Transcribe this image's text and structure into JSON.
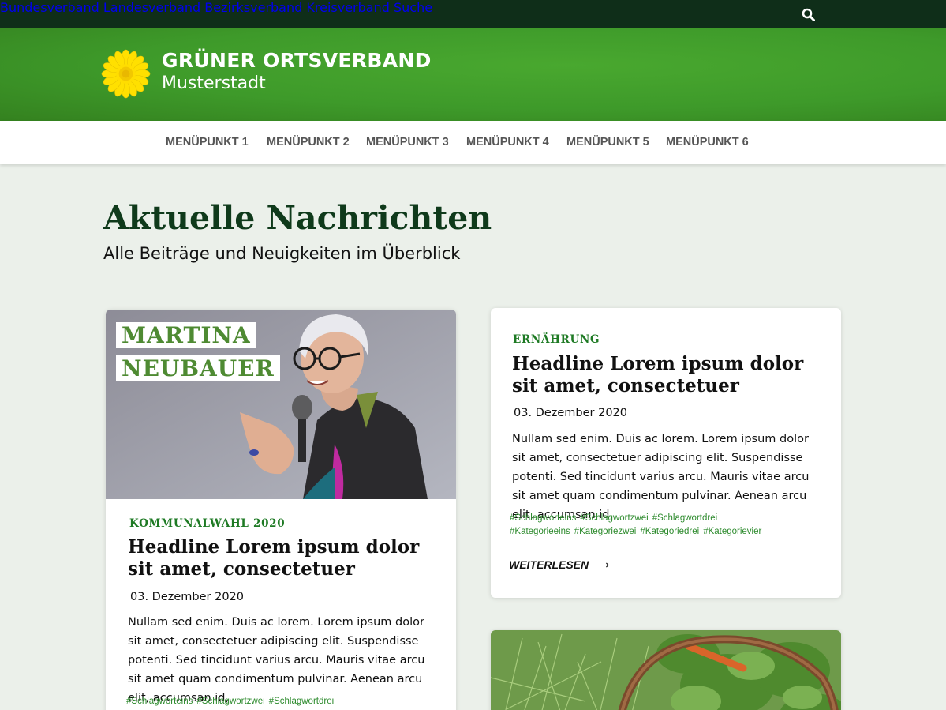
{
  "topbar": {
    "links": [
      "Bundesverband",
      "Landesverband",
      "Bezirksverband",
      "Kreisverband"
    ],
    "search_label": "Suche"
  },
  "header": {
    "org_name": "GRÜNER ORTSVERBAND",
    "city": "Musterstadt",
    "logo_icon": "sunflower-icon"
  },
  "mainnav": {
    "items": [
      "MENÜPUNKT 1",
      "MENÜPUNKT 2",
      "MENÜPUNKT 3",
      "MENÜPUNKT 4",
      "MENÜPUNKT 5",
      "MENÜPUNKT 6"
    ]
  },
  "page": {
    "title": "Aktuelle Nachrichten",
    "subtitle": "Alle Beiträge und Neuigkeiten im Überblick"
  },
  "cards": [
    {
      "image_label_line1": "MARTINA",
      "image_label_line2": "NEUBAUER",
      "kicker": "KOMMUNALWAHL 2020",
      "headline": "Headline Lorem ipsum dolor sit amet, consectetuer",
      "date": "03. Dezember 2020",
      "text": "Nullam sed enim. Duis ac lorem. Lorem ipsum dolor sit amet, consectetuer adipiscing elit. Suspendisse potenti. Sed tincidunt varius arcu. Mauris vitae arcu sit amet quam condimentum pulvinar. Aenean arcu elit, accumsan id,",
      "tags": [
        "#Schlagworteins",
        "#Schlagwortzwei",
        "#Schlagwortdrei"
      ]
    },
    {
      "kicker": "ERNÄHRUNG",
      "headline": "Headline Lorem ipsum dolor sit amet, consectetuer",
      "date": "03. Dezember 2020",
      "text": "Nullam sed enim. Duis ac lorem. Lorem ipsum dolor sit amet, consectetuer adipiscing elit. Suspendisse potenti. Sed tincidunt varius arcu. Mauris vitae arcu sit amet quam condimentum pulvinar. Aenean arcu elit, accumsan id,",
      "tags": [
        "#Schlagworteins",
        "#Schlagwortzwei",
        "#Schlagwortdrei"
      ],
      "categories": [
        "#Kategorieeins",
        "#Kategoriezwei",
        "#Kategoriedrei",
        "#Kategorievier"
      ],
      "readmore": "WEITERLESEN",
      "readmore_arrow": "⟶"
    }
  ],
  "colors": {
    "topbar": "#0f2e19",
    "header_green": "#3e9a2a",
    "title_green": "#0f3a1b",
    "kicker_green": "#1e7a24",
    "tag_green": "#2c8a2c",
    "page_bg": "#ebf0ea",
    "sunflower_yellow": "#ffe000"
  }
}
